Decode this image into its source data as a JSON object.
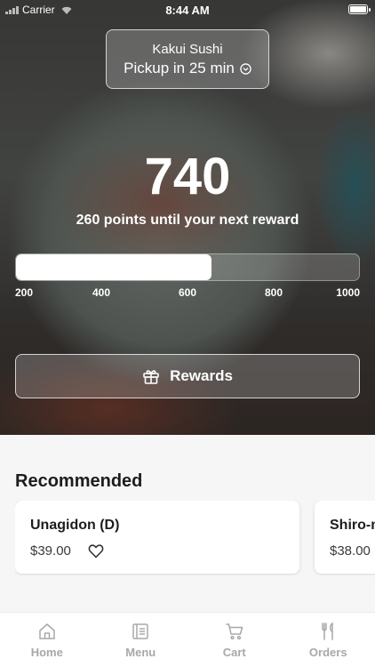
{
  "status_bar": {
    "carrier": "Carrier",
    "time": "8:44 AM"
  },
  "store": {
    "name": "Kakui Sushi",
    "pickup": "Pickup in 25 min"
  },
  "points": {
    "value": "740",
    "subtitle": "260 points until your next reward",
    "progress_fraction": 0.57
  },
  "ticks": [
    "200",
    "400",
    "600",
    "800",
    "1000"
  ],
  "rewards_button": {
    "label": "Rewards",
    "icon": "gift-icon"
  },
  "recommended": {
    "title": "Recommended",
    "items": [
      {
        "name": "Unagidon (D)",
        "price": "$39.00"
      },
      {
        "name": "Shiro-maguro",
        "price": "$38.00"
      }
    ]
  },
  "tabs": [
    {
      "label": "Home",
      "icon": "home-icon"
    },
    {
      "label": "Menu",
      "icon": "menu-icon"
    },
    {
      "label": "Cart",
      "icon": "cart-icon"
    },
    {
      "label": "Orders",
      "icon": "orders-icon"
    }
  ],
  "colors": {
    "tab_inactive": "#a8a8a8",
    "text_dark": "#1d1d1d"
  }
}
